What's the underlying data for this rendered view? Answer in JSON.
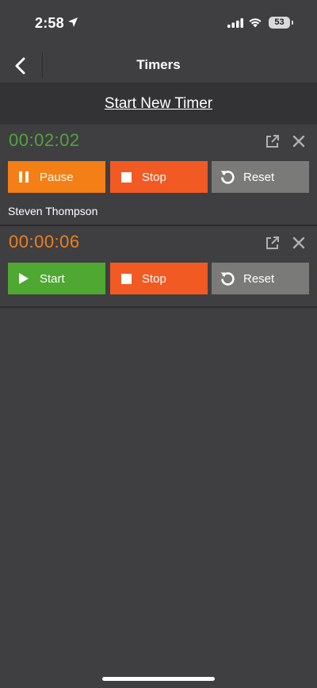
{
  "status_bar": {
    "time": "2:58",
    "battery": "53"
  },
  "nav": {
    "title": "Timers"
  },
  "start_new": {
    "label": "Start New Timer"
  },
  "timers": [
    {
      "time": "00:02:02",
      "time_color": "#54a23e",
      "primary": {
        "label": "Pause",
        "icon": "pause-icon",
        "color": "#f47f16"
      },
      "stop": {
        "label": "Stop",
        "icon": "stop-icon",
        "color": "#f25a24"
      },
      "reset": {
        "label": "Reset",
        "icon": "reset-icon",
        "color": "#7a7a78"
      },
      "owner": "Steven Thompson"
    },
    {
      "time": "00:00:06",
      "time_color": "#ec7f1f",
      "primary": {
        "label": "Start",
        "icon": "play-icon",
        "color": "#4ea831"
      },
      "stop": {
        "label": "Stop",
        "icon": "stop-icon",
        "color": "#f25a24"
      },
      "reset": {
        "label": "Reset",
        "icon": "reset-icon",
        "color": "#7a7a78"
      },
      "owner": ""
    }
  ]
}
